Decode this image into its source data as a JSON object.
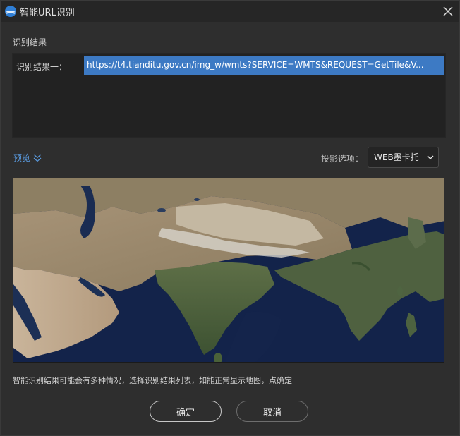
{
  "window": {
    "title": "智能URL识别"
  },
  "results": {
    "section_label": "识别结果",
    "items": [
      {
        "label": "识别结果一：",
        "url": "https://t4.tianditu.gov.cn/img_w/wmts?SERVICE=WMTS&REQUEST=GetTile&V..."
      }
    ]
  },
  "preview": {
    "toggle_label": "预览",
    "projection_label": "投影选项：",
    "projection_value": "WEB墨卡托"
  },
  "hint_text": "智能识别结果可能会有多种情况，选择识别结果列表，如能正常显示地图，点确定",
  "buttons": {
    "ok": "确定",
    "cancel": "取消"
  },
  "colors": {
    "accent": "#3d7ac4",
    "link": "#5a9be0",
    "background": "#2e2e2e"
  },
  "icons": [
    "app-logo-icon",
    "close-icon",
    "chevron-double-down-icon",
    "chevron-down-icon"
  ]
}
